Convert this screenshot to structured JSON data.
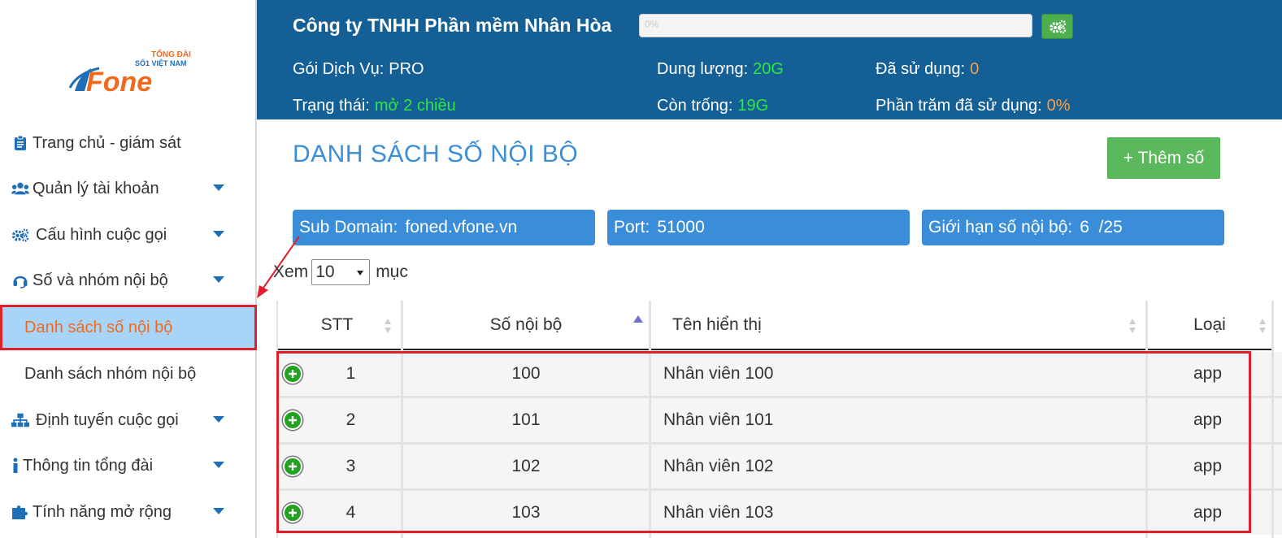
{
  "logo": {
    "top_text_1": "TỔNG ĐÀI",
    "top_text_2": "SỐ1 VIỆT NAM",
    "brand": "vFone"
  },
  "sidebar": {
    "items": [
      {
        "label": "Trang chủ - giám sát",
        "icon": "clipboard-icon"
      },
      {
        "label": "Quản lý tài khoản",
        "icon": "users-icon"
      },
      {
        "label": "Cấu hình cuộc gọi",
        "icon": "gears-icon"
      },
      {
        "label": "Số và nhóm nội bộ",
        "icon": "headset-icon"
      },
      {
        "label": "Danh sách số nội bộ",
        "icon": ""
      },
      {
        "label": "Danh sách nhóm nội bộ",
        "icon": ""
      },
      {
        "label": "Định tuyến cuộc gọi",
        "icon": "sitemap-icon"
      },
      {
        "label": "Thông tin tổng đài",
        "icon": "info-icon"
      },
      {
        "label": "Tính năng mở rộng",
        "icon": "puzzle-icon"
      }
    ]
  },
  "header": {
    "company": "Công ty TNHH Phần mềm Nhân Hòa",
    "progress_text": "0%",
    "service_label": "Gói Dịch Vụ:",
    "service_value": "PRO",
    "status_label": "Trạng thái:",
    "status_value": "mở 2 chiều",
    "capacity_label": "Dung lượng:",
    "capacity_value": "20G",
    "free_label": "Còn trống:",
    "free_value": "19G",
    "used_label": "Đã sử dụng:",
    "used_value": "0",
    "used_pct_label": "Phần trăm đã sử dụng:",
    "used_pct_value": "0%",
    "colors": {
      "bg": "#145f95",
      "value_green": "#2ee83f",
      "value_orange": "#f5a04a"
    }
  },
  "main": {
    "title": "DANH SÁCH SỐ NỘI BỘ",
    "add_button": "+ Thêm số",
    "subdomain_label": "Sub Domain:",
    "subdomain_value": "foned.vfone.vn",
    "port_label": "Port:",
    "port_value": "51000",
    "limit_label": "Giới hạn số nội bộ:",
    "limit_value": "6  /25",
    "show_prefix": "Xem",
    "show_value": "10",
    "show_suffix": "mục"
  },
  "table": {
    "headers": [
      "STT",
      "Số nội bộ",
      "Tên hiển thị",
      "Loại"
    ],
    "rows": [
      [
        "1",
        "100",
        "Nhân viên 100",
        "app"
      ],
      [
        "2",
        "101",
        "Nhân viên 101",
        "app"
      ],
      [
        "3",
        "102",
        "Nhân viên 102",
        "app"
      ],
      [
        "4",
        "103",
        "Nhân viên 103",
        "app"
      ]
    ]
  }
}
